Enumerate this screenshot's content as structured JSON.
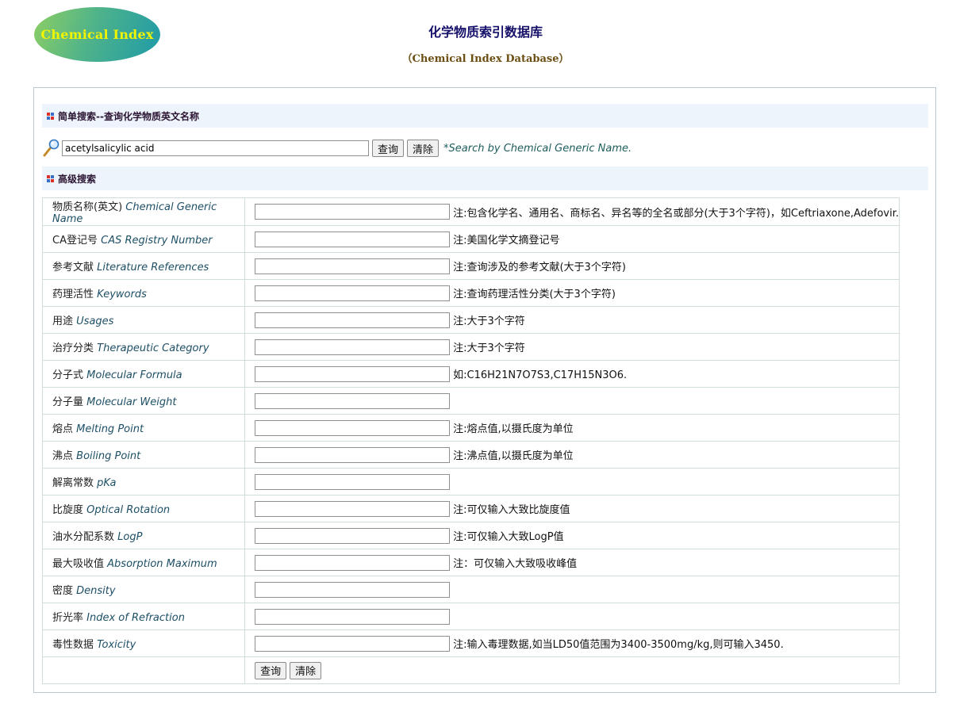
{
  "header": {
    "logo_text": "Chemical Index",
    "title": "化学物质索引数据库",
    "subtitle": "（Chemical Index Database）"
  },
  "simple_search": {
    "heading": "简单搜索--查询化学物质英文名称",
    "input_value": "acetylsalicylic acid",
    "query_button": "查询",
    "clear_button": "清除",
    "note": "*Search by Chemical Generic Name."
  },
  "advanced_search": {
    "heading": "高级搜索",
    "rows": [
      {
        "label_cn": "物质名称(英文)",
        "label_en": "Chemical Generic Name",
        "note": "注:包含化学名、通用名、商标名、异名等的全名或部分(大于3个字符)，如Ceftriaxone,Adefovir."
      },
      {
        "label_cn": "CA登记号",
        "label_en": "CAS Registry Number",
        "note": "注:美国化学文摘登记号"
      },
      {
        "label_cn": "参考文献",
        "label_en": "Literature References",
        "note": "注:查询涉及的参考文献(大于3个字符)"
      },
      {
        "label_cn": "药理活性",
        "label_en": "Keywords",
        "note": "注:查询药理活性分类(大于3个字符)"
      },
      {
        "label_cn": "用途",
        "label_en": "Usages",
        "note": "注:大于3个字符"
      },
      {
        "label_cn": "治疗分类",
        "label_en": "Therapeutic Category",
        "note": "注:大于3个字符"
      },
      {
        "label_cn": "分子式",
        "label_en": "Molecular Formula",
        "note": "如:C16H21N7O7S3,C17H15N3O6."
      },
      {
        "label_cn": "分子量",
        "label_en": "Molecular Weight",
        "note": ""
      },
      {
        "label_cn": "熔点",
        "label_en": "Melting Point",
        "note": "注:熔点值,以摄氏度为单位"
      },
      {
        "label_cn": "沸点",
        "label_en": "Boiling Point",
        "note": "注:沸点值,以摄氏度为单位"
      },
      {
        "label_cn": "解离常数",
        "label_en": "pKa",
        "note": ""
      },
      {
        "label_cn": "比旋度",
        "label_en": "Optical Rotation",
        "note": "注:可仅输入大致比旋度值"
      },
      {
        "label_cn": "油水分配系数",
        "label_en": "LogP",
        "note": "注:可仅输入大致LogP值"
      },
      {
        "label_cn": "最大吸收值",
        "label_en": "Absorption Maximum",
        "note": "注：可仅输入大致吸收峰值"
      },
      {
        "label_cn": "密度",
        "label_en": "Density",
        "note": ""
      },
      {
        "label_cn": "折光率",
        "label_en": "Index of Refraction",
        "note": ""
      },
      {
        "label_cn": "毒性数据",
        "label_en": "Toxicity",
        "note": "注:输入毒理数据,如当LD50值范围为3400-3500mg/kg,则可输入3450."
      }
    ],
    "query_button": "查询",
    "clear_button": "清除"
  },
  "colors": {
    "title": "#16116a",
    "subtitle": "#6b4e12",
    "section_bg": "#eef4fb",
    "logo_text": "#f1f500",
    "border": "#cfdedc"
  },
  "icons": [
    "magnifier-icon",
    "grid-bullet-icon"
  ]
}
